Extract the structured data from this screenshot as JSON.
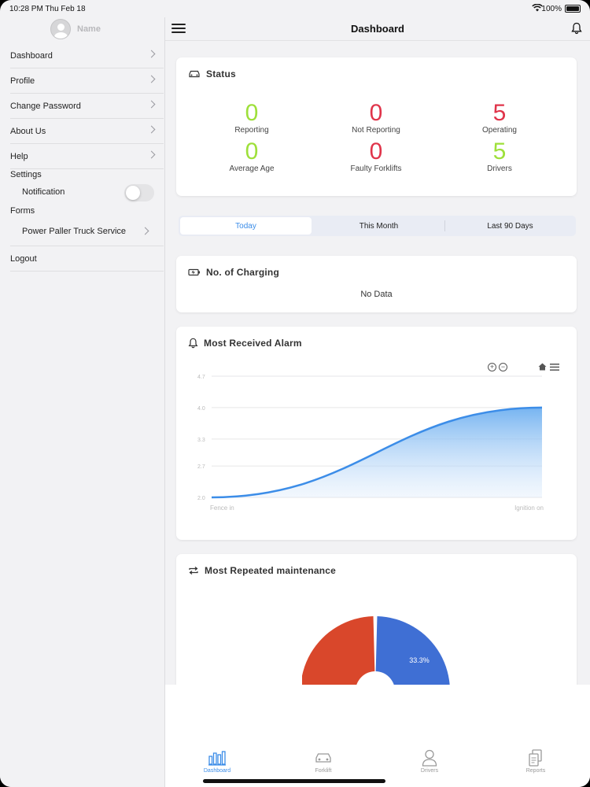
{
  "statusbar": {
    "time": "10:28 PM   Thu Feb 18",
    "battery": "100%"
  },
  "sidebar": {
    "profile_name": "Name",
    "items": [
      {
        "label": "Dashboard"
      },
      {
        "label": "Profile"
      },
      {
        "label": "Change Password"
      },
      {
        "label": "About Us"
      },
      {
        "label": "Help"
      }
    ],
    "settings_label": "Settings",
    "notification_label": "Notification",
    "notification_on": false,
    "forms_label": "Forms",
    "forms_item": "Power Paller Truck Service",
    "logout_label": "Logout"
  },
  "header": {
    "title": "Dashboard"
  },
  "status_card": {
    "title": "Status",
    "stats": [
      {
        "value": "0",
        "label": "Reporting",
        "color": "#9ee03a"
      },
      {
        "value": "0",
        "label": "Not Reporting",
        "color": "#e0344a"
      },
      {
        "value": "5",
        "label": "Operating",
        "color": "#e0344a"
      },
      {
        "value": "0",
        "label": "Average Age",
        "color": "#9ee03a"
      },
      {
        "value": "0",
        "label": "Faulty Forklifts",
        "color": "#e0344a"
      },
      {
        "value": "5",
        "label": "Drivers",
        "color": "#9ee03a"
      }
    ]
  },
  "period_tabs": {
    "today": "Today",
    "month": "This Month",
    "last90": "Last 90 Days",
    "active": "Today"
  },
  "charging_card": {
    "title": "No. of Charging",
    "empty": "No Data"
  },
  "alarm_card": {
    "title": "Most Received Alarm"
  },
  "maintenance_card": {
    "title": "Most Repeated maintenance"
  },
  "chart_data": [
    {
      "type": "area",
      "title": "Most Received Alarm",
      "categories": [
        "Fence in",
        "Ignition on"
      ],
      "values": [
        2.0,
        4.0
      ],
      "yticks": [
        "4.7",
        "4.0",
        "3.3",
        "2.7",
        "2.0"
      ],
      "ylim": [
        2.0,
        4.7
      ],
      "color": "#3c8de8"
    },
    {
      "type": "pie",
      "title": "Most Repeated maintenance",
      "slices": [
        {
          "label": "33.3%",
          "value": 33.3,
          "color": "#3f6fd4"
        },
        {
          "label": "",
          "value": 33.3,
          "color": "#d9472b"
        }
      ]
    }
  ],
  "tabbar": [
    {
      "label": "Dashboard",
      "active": true
    },
    {
      "label": "Forklift",
      "active": false
    },
    {
      "label": "Drivers",
      "active": false
    },
    {
      "label": "Reports",
      "active": false
    }
  ],
  "colors": {
    "accent": "#3c8de8",
    "good": "#9ee03a",
    "bad": "#e0344a"
  }
}
